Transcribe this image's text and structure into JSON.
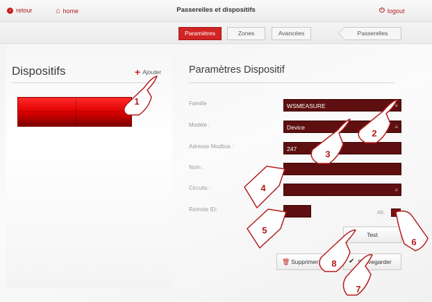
{
  "topbar": {
    "back_label": "retour",
    "home_label": "home",
    "title": "Passerelles et dispositifs",
    "logout_label": "logout"
  },
  "tabs": {
    "params": "Paramètres",
    "zones": "Zones",
    "advanced": "Avancées",
    "gateways": "Passerelles"
  },
  "left": {
    "title": "Dispositifs",
    "add_label": "Ajouter"
  },
  "right": {
    "title": "Paramètres Dispositif",
    "family_label": "Famille",
    "family_value": "WSMEASURE",
    "model_label": "Modèle :",
    "model_value": "Device",
    "modbus_label": "Adresse Modbus :",
    "modbus_value": "247",
    "name_label": "Nom :",
    "name_value": "",
    "circuits_label": "Circuits :",
    "circuits_value": "",
    "remote_label": "Remote ID:",
    "remote_value": "",
    "all_label": "All:",
    "test_label": "Test",
    "delete_label": "Supprimer",
    "save_label": "Sauvegarder"
  },
  "callouts": [
    "1",
    "2",
    "3",
    "4",
    "5",
    "6",
    "7",
    "8"
  ],
  "colors": {
    "accent": "#d12424",
    "field": "#5e0f0f",
    "callout": "#b21a1a"
  }
}
